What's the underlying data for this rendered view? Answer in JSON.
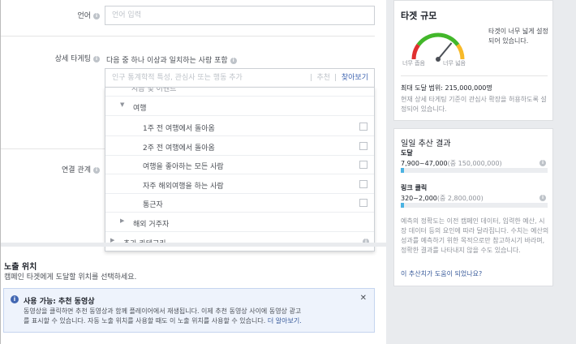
{
  "form": {
    "language_label": "언어",
    "language_placeholder": "언어 입력",
    "detailed_targeting_label": "상세 타게팅",
    "detailed_targeting_hint": "다음 중 하나 이상과 일치하는 사람 포함",
    "search_placeholder": "인구 통계학적 특성, 관심사 또는 행동 추가",
    "suggestions_label": "추천",
    "browse_label": "찾아보기",
    "connections_label": "연결 관계"
  },
  "dropdown": {
    "partial_row": "지금 및 이벤트",
    "travel_label": "여행",
    "items": [
      {
        "label": "1주 전 여행에서 돌아옴"
      },
      {
        "label": "2주 전 여행에서 돌아옴"
      },
      {
        "label": "여행을 좋아하는 모든 사람"
      },
      {
        "label": "자주 해외여행을 하는 사람"
      },
      {
        "label": "통근자"
      }
    ],
    "expats_label": "해외 거주자",
    "more_categories_label": "추가 카테고리"
  },
  "placement": {
    "title": "노출 위치",
    "subtitle": "캠페인 타겟에게 도달할 위치를 선택하세요."
  },
  "notice": {
    "title": "사용 가능: 추천 동영상",
    "body_line1": "동영상을 클릭하면 추천 동영상과 함께 플레이어에서 재생됩니다. 이제 추천 동영상 사이에 동영상 광고",
    "body_line2": "를 표시할 수 있습니다. 자동 노출 위치를 사용할 때도 이 노출 위치를 사용할 수 있습니다.",
    "learn_more": "더 알아보기."
  },
  "audience": {
    "title": "타겟 규모",
    "gauge_left_label": "너무 좁음",
    "gauge_right_label": "너무 넓음",
    "gauge_message": "타겟이 너무 넓게 설정되어 있습니다.",
    "gauge_level": 0.72,
    "reach_label": "최대 도달 범위: 215,000,000명",
    "reach_note": "현재 상세 타게팅 기준이 관심사 확장을 허용하도록 설정되어 있습니다."
  },
  "estimates": {
    "title": "일일 추산 결과",
    "reach_label": "도달",
    "reach_value": "7,900~47,000",
    "reach_total": "(중 150,000,000)",
    "reach_fill": 0.02,
    "clicks_label": "링크 클릭",
    "clicks_value": "320~2,000",
    "clicks_total": "(중 2,800,000)",
    "clicks_fill": 0.02,
    "disclaimer": "예측의 정확도는 이전 캠페인 데이터, 입력한 예산, 시장 데이터 등의 요인에 따라 달라집니다. 수치는 예산의 성과를 예측하기 위한 목적으로만 참고하시기 바라며, 정확한 결과를 나타내지 않을 수도 있습니다.",
    "feedback_link": "이 추산치가 도움이 되었나요?"
  },
  "colors": {
    "accent": "#4267b2",
    "bar_fill": "#4cb3e2",
    "gauge_red": "#e02f2f",
    "gauge_green": "#42b72a",
    "gauge_yellow": "#f7b928"
  }
}
